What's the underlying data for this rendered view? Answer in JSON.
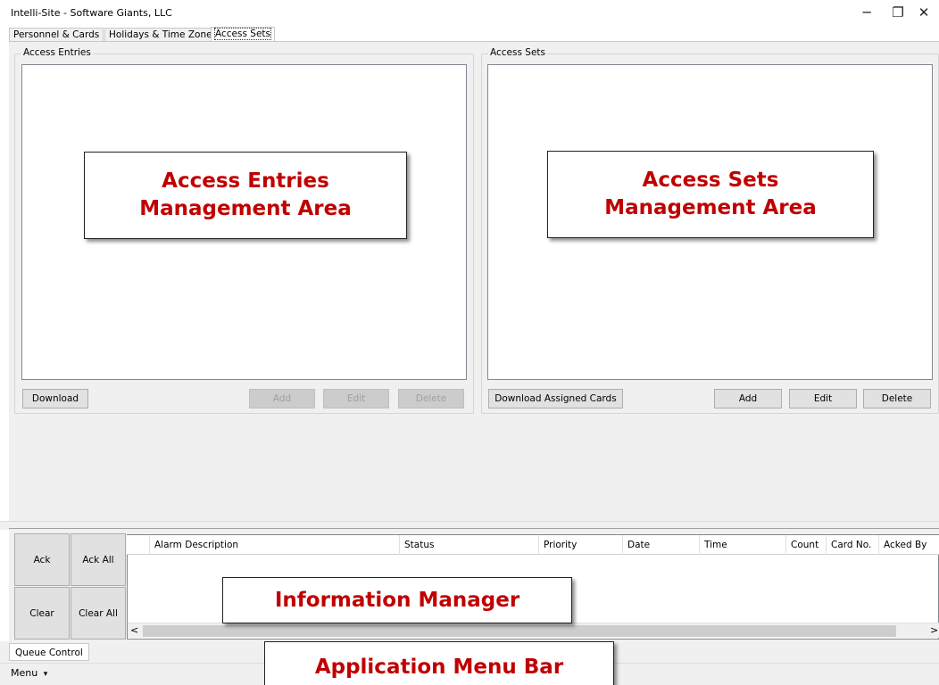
{
  "window": {
    "title": "Intelli-Site - Software Giants, LLC",
    "controls": {
      "minimize": "─",
      "restore": "❐",
      "close": "✕"
    }
  },
  "tabs": [
    {
      "label": "Personnel & Cards"
    },
    {
      "label": "Holidays & Time Zones"
    },
    {
      "label": "Access Sets"
    }
  ],
  "access_entries": {
    "group_title": "Access Entries",
    "buttons": {
      "download": "Download",
      "add": "Add",
      "edit": "Edit",
      "delete": "Delete"
    },
    "callout_line1": "Access Entries",
    "callout_line2": "Management Area"
  },
  "access_sets": {
    "group_title": "Access Sets",
    "buttons": {
      "download_assigned": "Download Assigned Cards",
      "add": "Add",
      "edit": "Edit",
      "delete": "Delete"
    },
    "callout_line1": "Access Sets",
    "callout_line2": "Management Area"
  },
  "queue": {
    "buttons": {
      "ack": "Ack",
      "ack_all": "Ack All",
      "clear": "Clear",
      "clear_all": "Clear All"
    },
    "columns": [
      "Alarm Description",
      "Status",
      "Priority",
      "Date",
      "Time",
      "Count",
      "Card No.",
      "Acked By"
    ],
    "scroll_left": "<",
    "scroll_right": ">",
    "callout": "Information Manager"
  },
  "bottom": {
    "queue_tab": "Queue Control",
    "menu": "Menu",
    "menu_arrow": "▾",
    "callout": "Application Menu Bar"
  },
  "colors": {
    "callout_text": "#c00000",
    "panel_bg": "#f0f0f0"
  }
}
